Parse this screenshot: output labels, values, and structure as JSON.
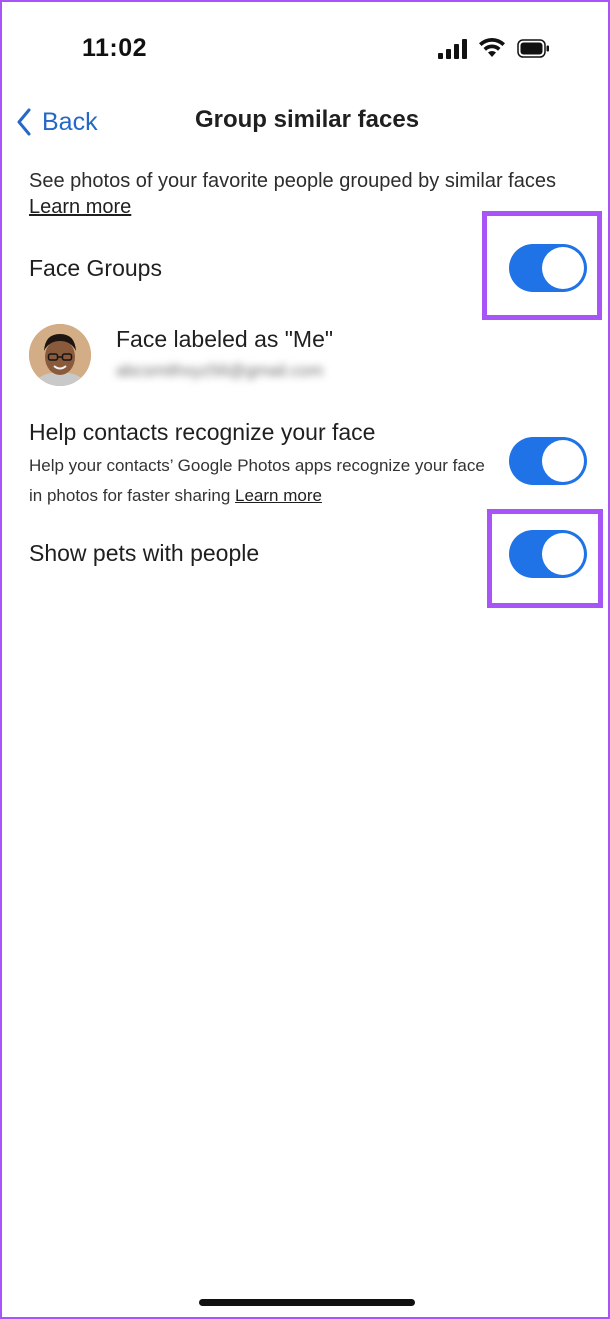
{
  "status_bar": {
    "time": "11:02"
  },
  "nav": {
    "back_label": "Back",
    "title": "Group similar faces"
  },
  "description": {
    "text": "See photos of your favorite people grouped by similar faces",
    "link": "Learn more"
  },
  "settings": {
    "face_groups": {
      "label": "Face Groups",
      "enabled": true
    },
    "face_labeled": {
      "label": "Face labeled as \"Me\"",
      "email": "abcsmithxyz56@gmail.com"
    },
    "help_contacts": {
      "label": "Help contacts recognize your face",
      "subtext": "Help your contacts’ Google Photos apps recognize your face in photos for faster sharing",
      "link": "Learn more",
      "enabled": true
    },
    "show_pets": {
      "label": "Show pets with people",
      "enabled": true
    }
  },
  "colors": {
    "accent": "#1f73e6",
    "link_blue": "#2468c8",
    "highlight": "#a855f7"
  }
}
